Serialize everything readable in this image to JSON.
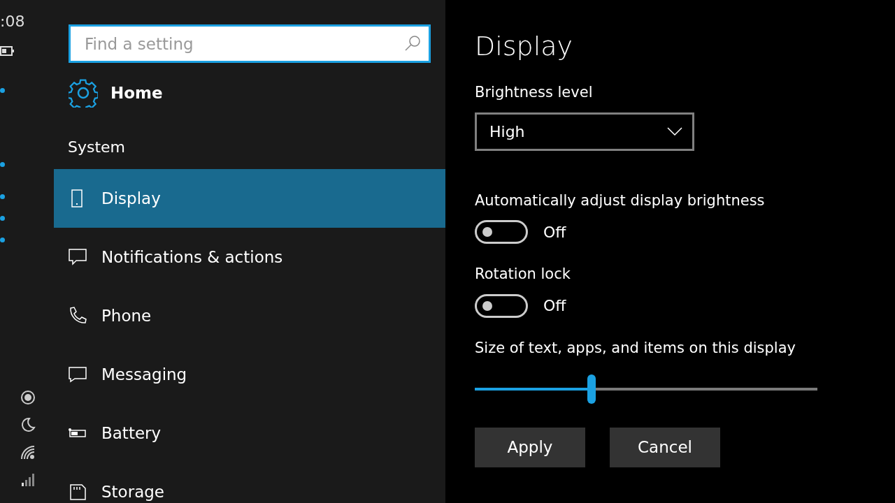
{
  "status_strip": {
    "time": ":08"
  },
  "search": {
    "placeholder": "Find a setting"
  },
  "home": {
    "label": "Home"
  },
  "section": "System",
  "nav_items": [
    {
      "label": "Display",
      "kind": "display",
      "selected": true
    },
    {
      "label": "Notifications & actions",
      "kind": "notifications",
      "selected": false
    },
    {
      "label": "Phone",
      "kind": "phone",
      "selected": false
    },
    {
      "label": "Messaging",
      "kind": "messaging",
      "selected": false
    },
    {
      "label": "Battery",
      "kind": "battery",
      "selected": false
    },
    {
      "label": "Storage",
      "kind": "storage",
      "selected": false
    }
  ],
  "page": {
    "title": "Display",
    "settings": [
      {
        "kind": "dropdown",
        "label": "Brightness level",
        "value": "High"
      },
      {
        "kind": "toggle",
        "label": "Automatically adjust display brightness",
        "on": false,
        "state_text": "Off"
      },
      {
        "kind": "toggle",
        "label": "Rotation lock",
        "on": false,
        "state_text": "Off"
      },
      {
        "kind": "slider",
        "label": "Size of text, apps, and items on this display",
        "level": 0.34
      }
    ],
    "buttons": [
      "Apply",
      "Cancel"
    ]
  }
}
